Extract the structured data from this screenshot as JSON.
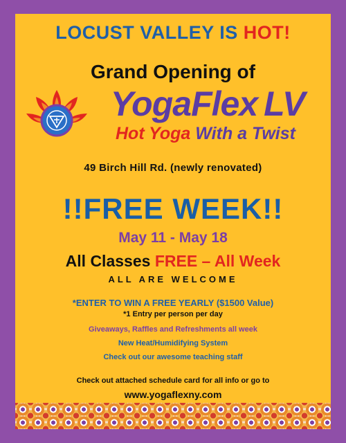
{
  "headline": {
    "part1": "LOCUST VALLEY ",
    "part2": "IS ",
    "part3": "HOT",
    "part4": "!"
  },
  "opening": "Grand Opening of",
  "brand": {
    "yoga": "Yoga",
    "flex": "Flex",
    "lv": "LV"
  },
  "tagline": {
    "hot": "Hot Yoga ",
    "rest": "With a Twist"
  },
  "address": "49 Birch Hill Rd. (newly renovated)",
  "free_week": "!!FREE WEEK!!",
  "dates": "May 11 - May 18",
  "classes": {
    "part1": "All Classes ",
    "part2": "FREE – All Week"
  },
  "welcome": "ALL ARE WELCOME",
  "enter": "*ENTER TO WIN A FREE YEARLY ($1500 Value)",
  "entry_note": "*1 Entry per person per day",
  "giveaways": "Giveaways, Raffles and Refreshments all week",
  "heat": "New Heat/Humidifying System",
  "staff": "Check out our awesome teaching staff",
  "schedule": "Check out attached schedule card for all info or go to",
  "url": "www.yogaflexny.com",
  "colors": {
    "border": "#8f4fa8",
    "background": "#ffc02a",
    "blue": "#1f5fa8",
    "red": "#e2261f",
    "purple": "#5b3da3"
  },
  "icons": {
    "logo": "lotus-chakra-icon",
    "pattern": "mandala-pattern"
  }
}
